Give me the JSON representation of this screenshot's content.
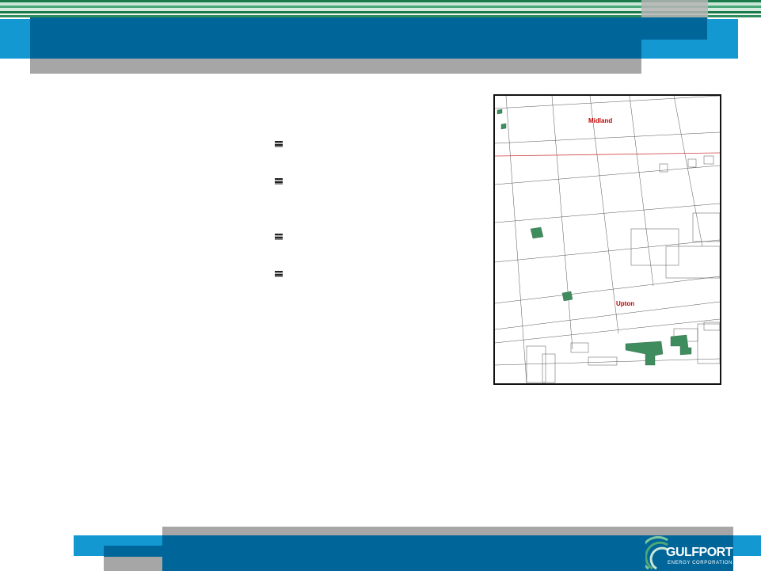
{
  "colors": {
    "brand_blue": "#006699",
    "accent_light_blue": "#1398d2",
    "band_gray": "#a6a6a6",
    "stripe_green": "#1a7a4a",
    "lease_green": "#3f8c5f",
    "county_label_red": "#c00000"
  },
  "bullets": [
    {
      "icon": "bullet-icon"
    },
    {
      "icon": "bullet-icon"
    },
    {
      "icon": "bullet-icon"
    },
    {
      "icon": "bullet-icon"
    }
  ],
  "map": {
    "counties": {
      "north": "Midland",
      "south": "Upton"
    }
  },
  "footer": {
    "logo": {
      "word": "GULFPORT",
      "sub": "ENERGY CORPORATION"
    }
  }
}
